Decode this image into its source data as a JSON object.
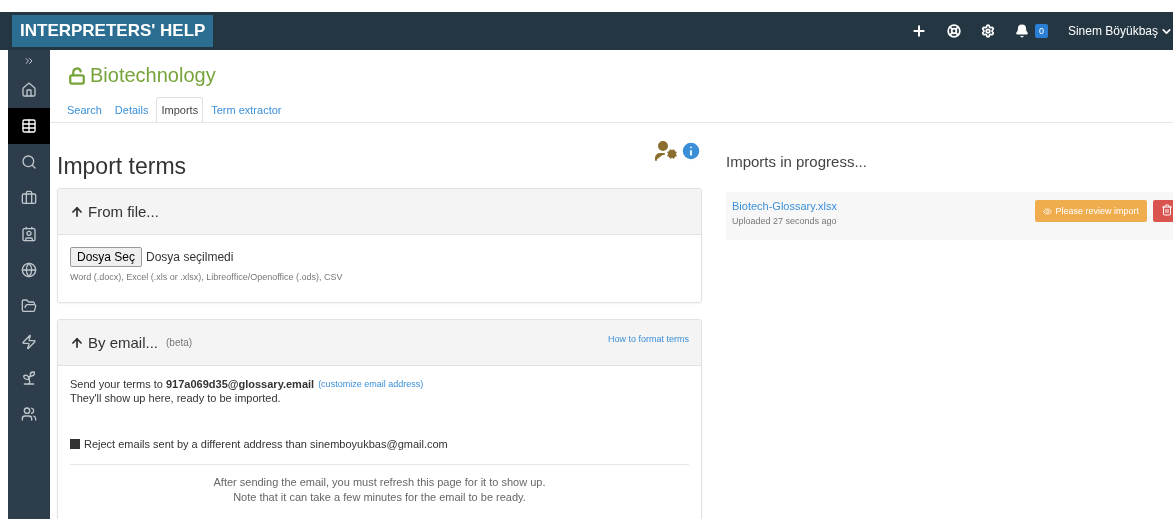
{
  "navbar": {
    "brand": "INTERPRETERS' HELP",
    "notifications": "0",
    "user": "Sinem Böyükbaş"
  },
  "sidebar": {
    "items": [
      {
        "selected": false
      },
      {
        "selected": true
      },
      {
        "selected": false
      },
      {
        "selected": false
      },
      {
        "selected": false
      },
      {
        "selected": false
      },
      {
        "selected": false
      },
      {
        "selected": false
      },
      {
        "selected": false
      },
      {
        "selected": false
      }
    ]
  },
  "glossary": {
    "title": "Biotechnology",
    "tabs": [
      {
        "label": "Search",
        "selected": false
      },
      {
        "label": "Details",
        "selected": false
      },
      {
        "label": "Imports",
        "selected": true
      },
      {
        "label": "Term extractor",
        "selected": false
      }
    ]
  },
  "import_terms": {
    "heading": "Import terms",
    "from_file": {
      "title": "From file...",
      "button": "Dosya Seç",
      "status": "Dosya seçilmedi",
      "formats": "Word (.docx), Excel (.xls or .xlsx), Libreoffice/Openoffice (.ods), CSV"
    },
    "by_email": {
      "title": "By email...",
      "badge": "(beta)",
      "help_link": "How to format terms",
      "send_line": "Send your terms to **917a069d35@glossary.email**",
      "customize_link": "(customize email address)",
      "note": "They'll show up here, ready to be imported.",
      "reject": {
        "label": "Reject emails sent by a different address than sinemboyukbas@gmail.com",
        "checked": true
      },
      "footer": [
        "After sending the email, you must refresh this page for it to show up.",
        "Note that it can take a few minutes for the email to be ready."
      ]
    }
  },
  "imports_in_progress": {
    "heading": "Imports in progress...",
    "items": [
      {
        "file": "Biotech-Glossary.xlsx",
        "uploaded": "Uploaded 27 seconds ago",
        "action": "Please review import"
      }
    ]
  }
}
